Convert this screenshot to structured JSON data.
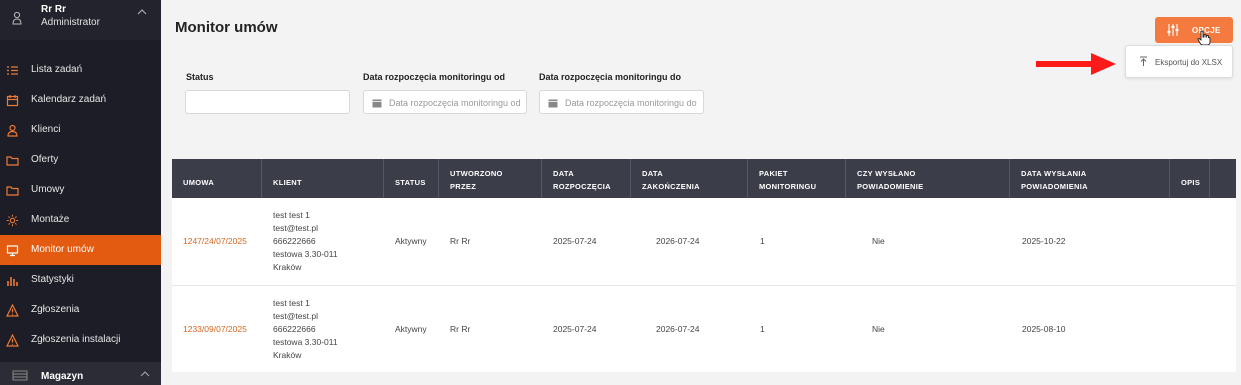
{
  "sidebar": {
    "user_name": "Rr Rr",
    "user_role": "Administrator",
    "items": [
      {
        "label": "Lista zadań",
        "icon": "list-icon"
      },
      {
        "label": "Kalendarz zadań",
        "icon": "calendar-icon"
      },
      {
        "label": "Klienci",
        "icon": "user-icon"
      },
      {
        "label": "Oferty",
        "icon": "folder-icon"
      },
      {
        "label": "Umowy",
        "icon": "folder-icon"
      },
      {
        "label": "Montaże",
        "icon": "sun-icon"
      },
      {
        "label": "Monitor umów",
        "icon": "monitor-icon",
        "active": true
      },
      {
        "label": "Statystyki",
        "icon": "bar-chart-icon"
      },
      {
        "label": "Zgłoszenia",
        "icon": "warning-icon"
      },
      {
        "label": "Zgłoszenia instalacji",
        "icon": "warning-icon"
      }
    ],
    "section_label": "Magazyn"
  },
  "header": {
    "title": "Monitor umów",
    "options_label": "OPCJE",
    "export_label": "Eksportuj do XLSX"
  },
  "filters": {
    "status_label": "Status",
    "status_value": "",
    "start_from_label": "Data rozpoczęcia monitoringu od",
    "start_from_placeholder": "Data rozpoczęcia monitoringu od",
    "start_to_label": "Data rozpoczęcia monitoringu do",
    "start_to_placeholder": "Data rozpoczęcia monitoringu do"
  },
  "table": {
    "headers": [
      [
        "UMOWA"
      ],
      [
        "KLIENT"
      ],
      [
        "STATUS"
      ],
      [
        "UTWORZONO",
        "PRZEZ"
      ],
      [
        "DATA",
        "ROZPOCZĘCIA"
      ],
      [
        "DATA",
        "ZAKOŃCZENIA"
      ],
      [
        "PAKIET",
        "MONITORINGU"
      ],
      [
        "CZY WYSŁANO",
        "POWIADOMIENIE"
      ],
      [
        "DATA WYSŁANIA",
        "POWIADOMIENIA"
      ],
      [
        "OPIS"
      ]
    ],
    "rows": [
      {
        "umowa": "1247/24/07/2025",
        "klient": [
          "test test 1",
          "test@test.pl",
          "666222666",
          "testowa 3.30-011",
          "Kraków"
        ],
        "status": "Aktywny",
        "utworzono": "Rr Rr",
        "data_rozp": "2025-07-24",
        "data_zak": "2026-07-24",
        "pakiet": "1",
        "wyslano": "Nie",
        "data_wysl": "2025-10-22"
      },
      {
        "umowa": "1233/09/07/2025",
        "klient": [
          "test test 1",
          "test@test.pl",
          "666222666",
          "testowa 3.30-011",
          "Kraków"
        ],
        "status": "Aktywny",
        "utworzono": "Rr Rr",
        "data_rozp": "2025-07-24",
        "data_zak": "2026-07-24",
        "pakiet": "1",
        "wyslano": "Nie",
        "data_wysl": "2025-08-10"
      }
    ]
  },
  "colors": {
    "accent": "#e25b10",
    "button": "#f47a3f",
    "sidebar_bg": "#1c1d26",
    "header_bg": "#3b3d48",
    "link": "#d8651e",
    "arrow": "#ff1a1a"
  }
}
